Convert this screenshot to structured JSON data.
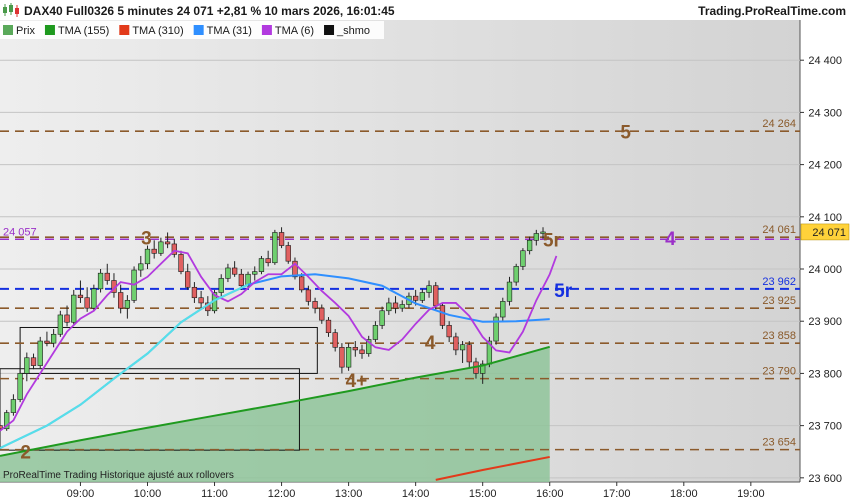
{
  "header": {
    "title": "DAX40 Full0326 5 minutes 24 071 +2,81 % 10 mars 2026, 16:01:45",
    "source": "Trading.ProRealTime.com"
  },
  "legend": [
    {
      "label": "Prix",
      "color": "#5aa95a",
      "icon": "candle-icon"
    },
    {
      "label": "TMA (155)",
      "color": "#1f9a1f",
      "icon": "swatch-icon"
    },
    {
      "label": "TMA (310)",
      "color": "#e23a1a",
      "icon": "swatch-icon"
    },
    {
      "label": "TMA (31)",
      "color": "#2f8fff",
      "icon": "swatch-icon"
    },
    {
      "label": "TMA (6)",
      "color": "#b23adf",
      "icon": "swatch-icon"
    },
    {
      "label": "_shmo",
      "color": "#111111",
      "icon": "swatch-icon"
    }
  ],
  "footer": "ProRealTime Trading  Historique ajusté aux rollovers",
  "chart_data": {
    "type": "candlestick",
    "y_ticks": [
      23600,
      23700,
      23800,
      23900,
      24000,
      24100,
      24200,
      24300,
      24400
    ],
    "y_tick_labels": [
      "23 600",
      "23 700",
      "23 800",
      "23 900",
      "24 000",
      "24 100",
      "24 200",
      "24 300",
      "24 400"
    ],
    "ylim": [
      23592,
      24477
    ],
    "x_ticks": [
      "09:00",
      "10:00",
      "11:00",
      "12:00",
      "13:00",
      "14:00",
      "15:00",
      "16:00",
      "17:00",
      "18:00",
      "19:00"
    ],
    "x_tick_minutes": [
      540,
      600,
      660,
      720,
      780,
      840,
      900,
      960,
      1020,
      1080,
      1140
    ],
    "xlim_minutes": [
      468,
      1184
    ],
    "last_price": {
      "value": 24071,
      "label": "24 071"
    },
    "levels": [
      {
        "value": 24264,
        "label": "24 264",
        "style": "dashed",
        "color": "#8b5a2b"
      },
      {
        "value": 24061,
        "label": "24 061",
        "style": "dashed",
        "color": "#8b5a2b"
      },
      {
        "value": 24057,
        "label": "24 057",
        "style": "dashed",
        "color": "#9b30c8",
        "label_side": "left"
      },
      {
        "value": 23962,
        "label": "23 962",
        "style": "dashed",
        "color": "#1530e0"
      },
      {
        "value": 23925,
        "label": "23 925",
        "style": "dashed",
        "color": "#8b5a2b"
      },
      {
        "value": 23858,
        "label": "23 858",
        "style": "dashed",
        "color": "#8b5a2b"
      },
      {
        "value": 23790,
        "label": "23 790",
        "style": "dashed",
        "color": "#8b5a2b"
      },
      {
        "value": 23654,
        "label": "23 654",
        "style": "dashed",
        "color": "#8b5a2b"
      }
    ],
    "wave_labels": [
      {
        "text": "2",
        "t": 491,
        "y": 23650,
        "color": "#8b5a2b"
      },
      {
        "text": "3",
        "t": 599,
        "y": 24060,
        "color": "#8b5a2b"
      },
      {
        "text": "4+",
        "t": 787,
        "y": 23787,
        "color": "#8b5a2b"
      },
      {
        "text": "4",
        "t": 853,
        "y": 23860,
        "color": "#8b5a2b"
      },
      {
        "text": "5r",
        "t": 972,
        "y": 23960,
        "color": "#1530e0"
      },
      {
        "text": "5r",
        "t": 962,
        "y": 24057,
        "color": "#8b5a2b"
      },
      {
        "text": "5",
        "t": 1028,
        "y": 24263,
        "color": "#8b5a2b"
      },
      {
        "text": "4",
        "t": 1068,
        "y": 24059,
        "color": "#9b30c8"
      }
    ],
    "boxes": [
      {
        "t0": 486,
        "t1": 752,
        "y0": 23800,
        "y1": 23888
      },
      {
        "t0": 468,
        "t1": 736,
        "y0": 23653,
        "y1": 23809
      }
    ],
    "series": [
      {
        "name": "TMA (155)",
        "color": "#1f9a1f",
        "fill": "#8fc49a",
        "points": [
          [
            468,
            23642
          ],
          [
            540,
            23672
          ],
          [
            600,
            23696
          ],
          [
            660,
            23719
          ],
          [
            720,
            23742
          ],
          [
            780,
            23766
          ],
          [
            840,
            23792
          ],
          [
            900,
            23815
          ],
          [
            960,
            23851
          ]
        ]
      },
      {
        "name": "TMA (310)",
        "color": "#e23a1a",
        "points": [
          [
            858,
            23596
          ],
          [
            900,
            23615
          ],
          [
            960,
            23640
          ]
        ]
      },
      {
        "name": "TMA (31)",
        "color": "#2f8fff",
        "points": [
          [
            468,
            23657
          ],
          [
            510,
            23700
          ],
          [
            540,
            23740
          ],
          [
            570,
            23790
          ],
          [
            600,
            23838
          ],
          [
            630,
            23898
          ],
          [
            660,
            23940
          ],
          [
            690,
            23970
          ],
          [
            720,
            23986
          ],
          [
            750,
            23990
          ],
          [
            780,
            23982
          ],
          [
            810,
            23968
          ],
          [
            840,
            23934
          ],
          [
            870,
            23912
          ],
          [
            900,
            23899
          ],
          [
            930,
            23900
          ],
          [
            960,
            23904
          ]
        ]
      },
      {
        "name": "TMA (6)",
        "color": "#b23adf",
        "points": [
          [
            468,
            23690
          ],
          [
            480,
            23710
          ],
          [
            492,
            23760
          ],
          [
            504,
            23800
          ],
          [
            516,
            23840
          ],
          [
            528,
            23880
          ],
          [
            540,
            23905
          ],
          [
            552,
            23920
          ],
          [
            564,
            23950
          ],
          [
            576,
            23975
          ],
          [
            588,
            23970
          ],
          [
            600,
            23985
          ],
          [
            612,
            24010
          ],
          [
            624,
            24035
          ],
          [
            636,
            24030
          ],
          [
            648,
            23985
          ],
          [
            660,
            23950
          ],
          [
            672,
            23938
          ],
          [
            684,
            23952
          ],
          [
            696,
            23975
          ],
          [
            708,
            23990
          ],
          [
            720,
            23990
          ],
          [
            732,
            24010
          ],
          [
            744,
            23985
          ],
          [
            756,
            23958
          ],
          [
            768,
            23935
          ],
          [
            780,
            23910
          ],
          [
            792,
            23870
          ],
          [
            804,
            23850
          ],
          [
            816,
            23845
          ],
          [
            828,
            23865
          ],
          [
            840,
            23895
          ],
          [
            852,
            23922
          ],
          [
            864,
            23935
          ],
          [
            876,
            23935
          ],
          [
            888,
            23910
          ],
          [
            900,
            23870
          ],
          [
            912,
            23844
          ],
          [
            924,
            23840
          ],
          [
            936,
            23880
          ],
          [
            948,
            23940
          ],
          [
            960,
            23990
          ],
          [
            966,
            24025
          ]
        ]
      }
    ],
    "candles": [
      [
        468,
        23700,
        23715,
        23688,
        23694
      ],
      [
        474,
        23694,
        23730,
        23690,
        23725
      ],
      [
        480,
        23725,
        23760,
        23719,
        23750
      ],
      [
        486,
        23750,
        23810,
        23745,
        23800
      ],
      [
        492,
        23800,
        23840,
        23785,
        23830
      ],
      [
        498,
        23830,
        23838,
        23808,
        23815
      ],
      [
        504,
        23815,
        23870,
        23810,
        23862
      ],
      [
        510,
        23862,
        23880,
        23852,
        23858
      ],
      [
        516,
        23858,
        23885,
        23850,
        23875
      ],
      [
        522,
        23875,
        23920,
        23870,
        23912
      ],
      [
        528,
        23912,
        23930,
        23890,
        23898
      ],
      [
        534,
        23898,
        23960,
        23892,
        23950
      ],
      [
        540,
        23950,
        23978,
        23935,
        23945
      ],
      [
        546,
        23945,
        23965,
        23918,
        23925
      ],
      [
        552,
        23925,
        23970,
        23920,
        23962
      ],
      [
        558,
        23962,
        24000,
        23955,
        23992
      ],
      [
        564,
        23992,
        24010,
        23970,
        23978
      ],
      [
        570,
        23978,
        23992,
        23945,
        23955
      ],
      [
        576,
        23955,
        23970,
        23915,
        23925
      ],
      [
        582,
        23925,
        23950,
        23905,
        23940
      ],
      [
        588,
        23940,
        24005,
        23935,
        23998
      ],
      [
        594,
        23998,
        24025,
        23985,
        24010
      ],
      [
        600,
        24010,
        24045,
        24000,
        24038
      ],
      [
        606,
        24038,
        24055,
        24020,
        24030
      ],
      [
        612,
        24030,
        24060,
        24025,
        24052
      ],
      [
        618,
        24052,
        24070,
        24040,
        24048
      ],
      [
        624,
        24048,
        24058,
        24022,
        24028
      ],
      [
        630,
        24028,
        24035,
        23990,
        23995
      ],
      [
        636,
        23995,
        24010,
        23960,
        23965
      ],
      [
        642,
        23965,
        23975,
        23935,
        23945
      ],
      [
        648,
        23945,
        23958,
        23925,
        23935
      ],
      [
        654,
        23935,
        23948,
        23910,
        23920
      ],
      [
        660,
        23920,
        23960,
        23915,
        23955
      ],
      [
        666,
        23955,
        23990,
        23945,
        23982
      ],
      [
        672,
        23982,
        24010,
        23975,
        24002
      ],
      [
        678,
        24002,
        24015,
        23985,
        23990
      ],
      [
        684,
        23990,
        24000,
        23960,
        23968
      ],
      [
        690,
        23968,
        23995,
        23962,
        23990
      ],
      [
        696,
        23990,
        24005,
        23978,
        23995
      ],
      [
        702,
        23995,
        24025,
        23990,
        24020
      ],
      [
        708,
        24020,
        24035,
        24005,
        24012
      ],
      [
        714,
        24012,
        24075,
        24008,
        24070
      ],
      [
        720,
        24070,
        24080,
        24040,
        24045
      ],
      [
        726,
        24045,
        24052,
        24010,
        24015
      ],
      [
        732,
        24015,
        24022,
        23980,
        23985
      ],
      [
        738,
        23985,
        23992,
        23955,
        23960
      ],
      [
        744,
        23960,
        23968,
        23930,
        23938
      ],
      [
        750,
        23938,
        23945,
        23915,
        23925
      ],
      [
        756,
        23925,
        23932,
        23895,
        23902
      ],
      [
        762,
        23902,
        23908,
        23870,
        23878
      ],
      [
        768,
        23878,
        23885,
        23842,
        23850
      ],
      [
        774,
        23850,
        23858,
        23800,
        23812
      ],
      [
        780,
        23812,
        23858,
        23805,
        23850
      ],
      [
        786,
        23850,
        23862,
        23832,
        23845
      ],
      [
        792,
        23845,
        23855,
        23828,
        23838
      ],
      [
        798,
        23838,
        23872,
        23832,
        23865
      ],
      [
        804,
        23865,
        23900,
        23860,
        23892
      ],
      [
        810,
        23892,
        23928,
        23885,
        23920
      ],
      [
        816,
        23920,
        23945,
        23912,
        23935
      ],
      [
        822,
        23935,
        23948,
        23915,
        23925
      ],
      [
        828,
        23925,
        23940,
        23918,
        23932
      ],
      [
        834,
        23932,
        23955,
        23925,
        23948
      ],
      [
        840,
        23948,
        23960,
        23930,
        23940
      ],
      [
        846,
        23940,
        23962,
        23935,
        23955
      ],
      [
        852,
        23955,
        23978,
        23945,
        23968
      ],
      [
        858,
        23968,
        23975,
        23920,
        23930
      ],
      [
        864,
        23930,
        23935,
        23885,
        23892
      ],
      [
        870,
        23892,
        23900,
        23860,
        23870
      ],
      [
        876,
        23870,
        23878,
        23835,
        23845
      ],
      [
        882,
        23845,
        23862,
        23820,
        23855
      ],
      [
        888,
        23855,
        23862,
        23812,
        23822
      ],
      [
        894,
        23822,
        23830,
        23790,
        23800
      ],
      [
        900,
        23800,
        23825,
        23780,
        23818
      ],
      [
        906,
        23818,
        23870,
        23812,
        23862
      ],
      [
        912,
        23862,
        23915,
        23855,
        23908
      ],
      [
        918,
        23908,
        23945,
        23900,
        23938
      ],
      [
        924,
        23938,
        23985,
        23930,
        23975
      ],
      [
        930,
        23975,
        24010,
        23968,
        24005
      ],
      [
        936,
        24005,
        24040,
        23998,
        24035
      ],
      [
        942,
        24035,
        24062,
        24028,
        24055
      ],
      [
        948,
        24055,
        24075,
        24045,
        24068
      ],
      [
        954,
        24068,
        24080,
        24058,
        24071
      ]
    ]
  }
}
